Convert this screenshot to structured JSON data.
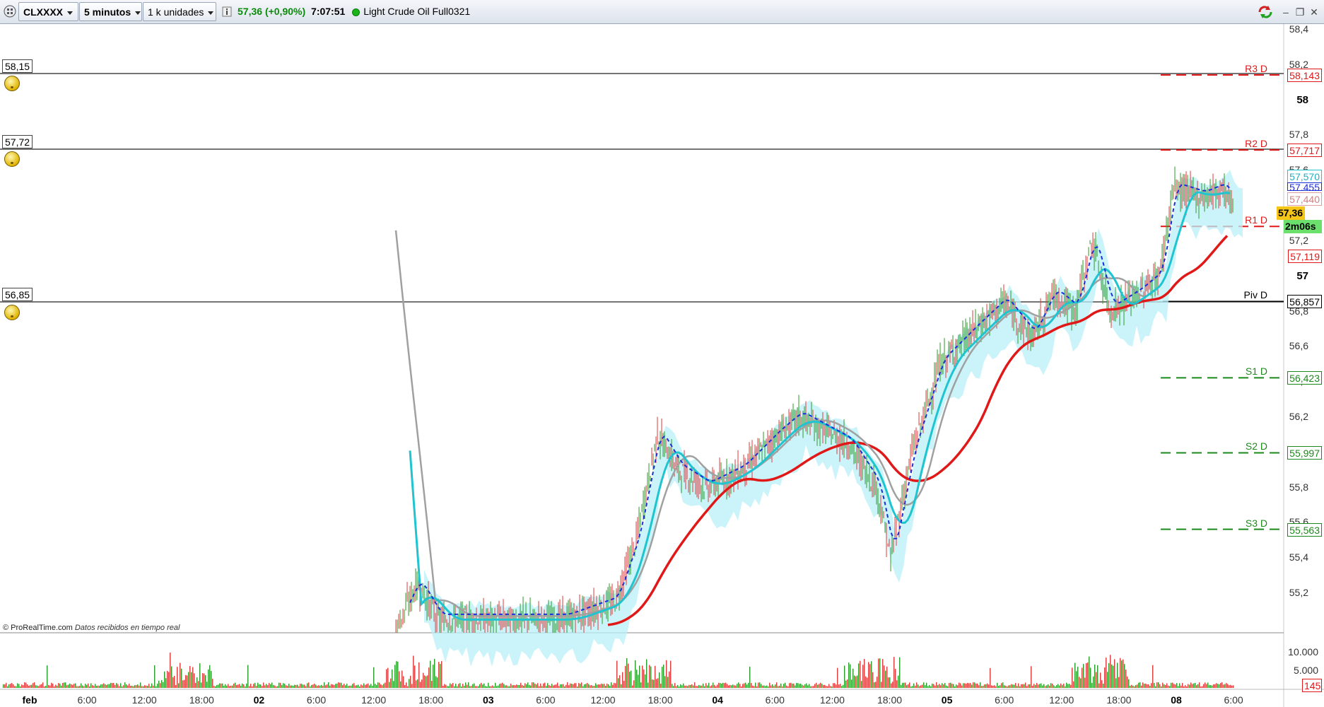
{
  "toolbar": {
    "symbol": "CLXXXX",
    "interval": "5 minutos",
    "units": "1 k unidades",
    "info_icon": "info-icon",
    "last_price": "57,36",
    "change": "(+0,90%)",
    "time": "7:07:51",
    "status_color": "#18b418",
    "instrument": "Light Crude Oil Full0321"
  },
  "chart": {
    "credit_brand": "© ProRealTime.com",
    "credit_text": "Datos recibidos en tiempo real",
    "alert_levels": [
      "58,15",
      "57,72",
      "56,85"
    ],
    "price_axis_labels": [
      "58,4",
      "58,2",
      "58",
      "57,8",
      "57,6",
      "57,2",
      "57",
      "56,8",
      "56,6",
      "56,4",
      "56,2",
      "56",
      "55,8",
      "55,6",
      "55,4",
      "55,2"
    ],
    "pivots": [
      {
        "name": "R3 D",
        "value": "58,143",
        "color": "#e01818"
      },
      {
        "name": "R2 D",
        "value": "57,717",
        "color": "#e01818"
      },
      {
        "name": "R1 D",
        "value": "57,283",
        "color": "#e01818"
      },
      {
        "name": "Piv D",
        "value": "56,857",
        "color": "#000000"
      },
      {
        "name": "S1 D",
        "value": "56,423",
        "color": "#1a8a1a"
      },
      {
        "name": "S2 D",
        "value": "55,997",
        "color": "#1a8a1a"
      },
      {
        "name": "S3 D",
        "value": "55,563",
        "color": "#1a8a1a"
      }
    ],
    "indicator_tags": {
      "cyan": "57,570",
      "blue_dash": "57,455",
      "pink": "57,440",
      "last": "57,36",
      "countdown": "2m06s",
      "red_ma": "57,119"
    },
    "volume_axis": [
      "10.000",
      "5.000"
    ],
    "volume_last": "145",
    "time_axis": [
      "feb",
      "6:00",
      "12:00",
      "18:00",
      "02",
      "6:00",
      "12:00",
      "18:00",
      "03",
      "6:00",
      "12:00",
      "18:00",
      "04",
      "6:00",
      "12:00",
      "18:00",
      "05",
      "6:00",
      "12:00",
      "18:00",
      "08",
      "6:00"
    ],
    "colors": {
      "ema_fast": "#20c4d0",
      "ema_slow": "#e01818",
      "dashed_ma": "#1a2fd8",
      "gray_line": "#a0a0a0",
      "cloud": "#b8f0f8",
      "candle_up": "#2a9a2a",
      "candle_down": "#e03a3a"
    }
  }
}
